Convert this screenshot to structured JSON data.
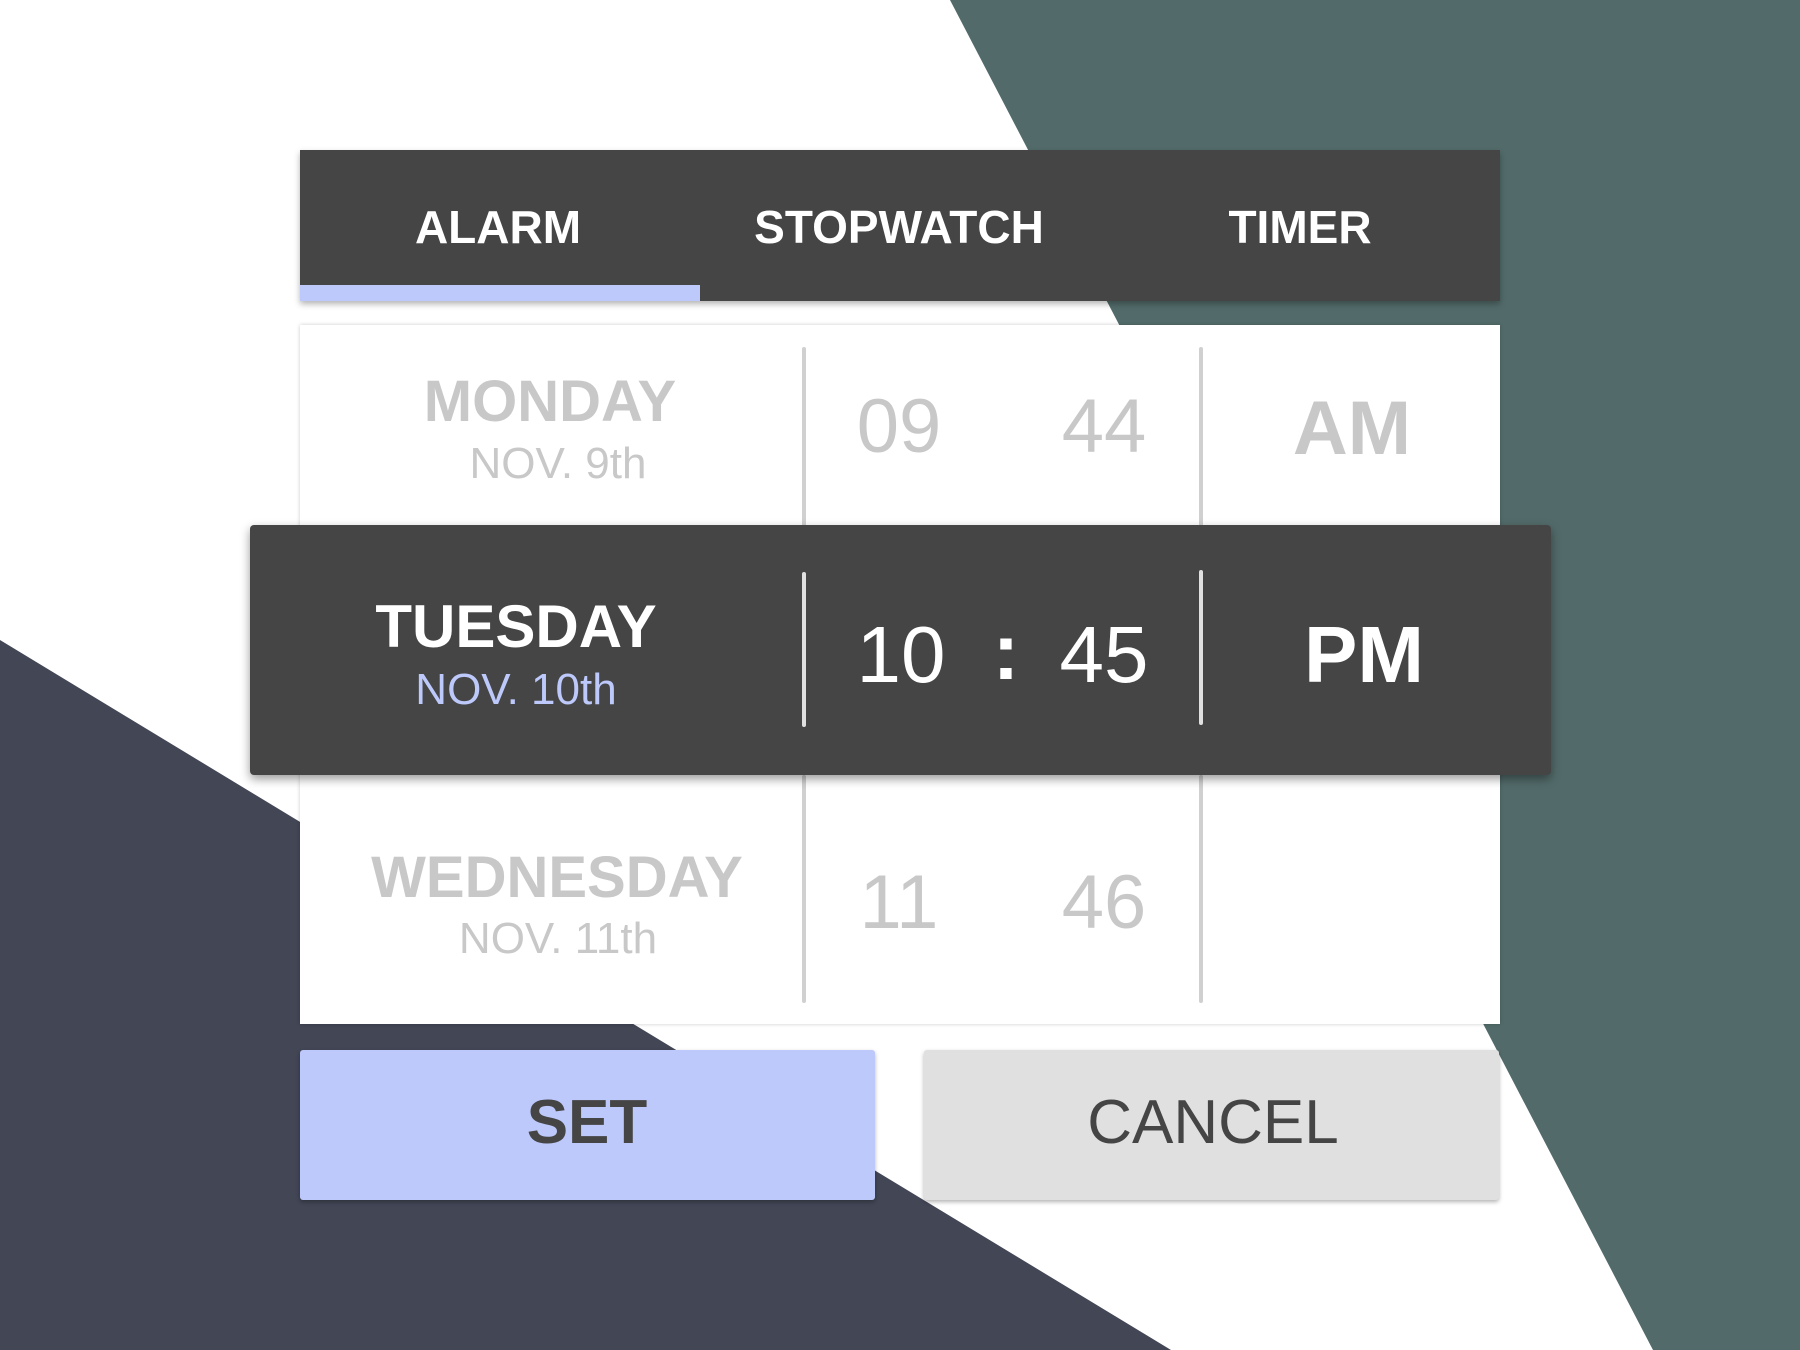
{
  "colors": {
    "accent": "#bdc9fb",
    "dark": "#454545",
    "teal": "#526b6a",
    "navy": "#424655",
    "muted": "#c8c8c8"
  },
  "tabs": [
    {
      "label": "ALARM",
      "active": true
    },
    {
      "label": "STOPWATCH",
      "active": false
    },
    {
      "label": "TIMER",
      "active": false
    }
  ],
  "picker": {
    "previous": {
      "day": "MONDAY",
      "date": "NOV. 9th",
      "hour": "09",
      "minute": "44",
      "period": "AM"
    },
    "selected": {
      "day": "TUESDAY",
      "date": "NOV. 10th",
      "hour": "10",
      "separator": ":",
      "minute": "45",
      "period": "PM"
    },
    "next": {
      "day": "WEDNESDAY",
      "date": "NOV. 11th",
      "hour": "11",
      "minute": "46",
      "period": ""
    }
  },
  "buttons": {
    "set": "SET",
    "cancel": "CANCEL"
  }
}
